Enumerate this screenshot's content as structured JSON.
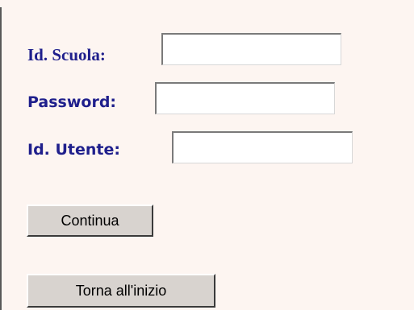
{
  "form": {
    "school_id_label": "Id. Scuola:",
    "school_id_value": "",
    "password_label": "Password:",
    "password_value": "",
    "user_id_label": "Id. Utente:",
    "user_id_value": ""
  },
  "buttons": {
    "continue_label": "Continua",
    "back_label": "Torna all'inizio"
  },
  "colors": {
    "panel_background": "#fdf5f1",
    "label_color": "#1f1f8c",
    "button_face": "#d8d3cf"
  }
}
